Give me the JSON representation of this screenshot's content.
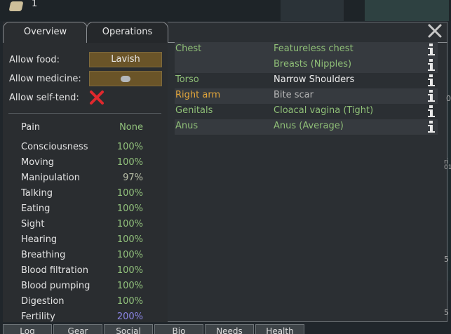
{
  "top": {
    "count": "1"
  },
  "tabs": {
    "overview": "Overview",
    "operations": "Operations"
  },
  "settings": {
    "allow_food_label": "Allow food:",
    "allow_food_value": "Lavish",
    "allow_medicine_label": "Allow medicine:",
    "allow_self_tend_label": "Allow self-tend:"
  },
  "pain": {
    "name": "Pain",
    "value": "None"
  },
  "capacities": [
    {
      "name": "Consciousness",
      "value": "100%"
    },
    {
      "name": "Moving",
      "value": "100%"
    },
    {
      "name": "Manipulation",
      "value": "97%"
    },
    {
      "name": "Talking",
      "value": "100%"
    },
    {
      "name": "Eating",
      "value": "100%"
    },
    {
      "name": "Sight",
      "value": "100%"
    },
    {
      "name": "Hearing",
      "value": "100%"
    },
    {
      "name": "Breathing",
      "value": "100%"
    },
    {
      "name": "Blood filtration",
      "value": "100%"
    },
    {
      "name": "Blood pumping",
      "value": "100%"
    },
    {
      "name": "Digestion",
      "value": "100%"
    },
    {
      "name": "Fertility",
      "value": "200%"
    }
  ],
  "hediffs": [
    {
      "part": "Chest",
      "condition": "Featureless chest"
    },
    {
      "part": "",
      "condition": "Breasts (Nipples)"
    },
    {
      "part": "Torso",
      "condition": "Narrow Shoulders"
    },
    {
      "part": "Right arm",
      "condition": "Bite scar"
    },
    {
      "part": "Genitals",
      "condition": "Cloacal vagina (Tight)"
    },
    {
      "part": "Anus",
      "condition": "Anus (Average)"
    }
  ],
  "bottom_tabs": [
    "Log",
    "Gear",
    "Social",
    "Bio",
    "Needs",
    "Health"
  ],
  "side_numbers": [
    "0",
    "ri",
    "01",
    "5",
    "5"
  ],
  "colors": {
    "good": "#8fbf77",
    "injury_part": "#e3a63b",
    "fertility": "#8c86e6",
    "button": "#6a5428",
    "deny": "#e0282d"
  }
}
